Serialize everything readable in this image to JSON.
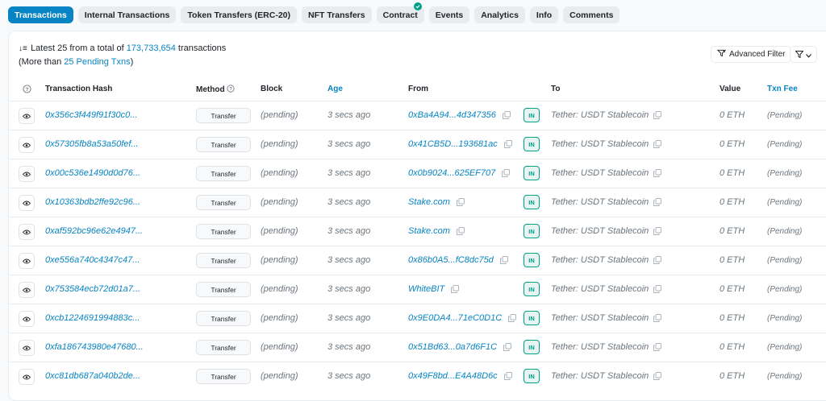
{
  "tabs": [
    {
      "label": "Transactions",
      "active": true
    },
    {
      "label": "Internal Transactions"
    },
    {
      "label": "Token Transfers (ERC-20)"
    },
    {
      "label": "NFT Transfers"
    },
    {
      "label": "Contract",
      "verified": true
    },
    {
      "label": "Events"
    },
    {
      "label": "Analytics"
    },
    {
      "label": "Info"
    },
    {
      "label": "Comments"
    }
  ],
  "summary": {
    "prefix": "Latest 25 from a total of ",
    "total": "173,733,654",
    "suffix": " transactions",
    "pending_prefix": "(More than ",
    "pending_link": "25 Pending Txns",
    "pending_suffix": ")"
  },
  "toolbar": {
    "advanced_filter": "Advanced Filter"
  },
  "columns": {
    "hash": "Transaction Hash",
    "method": "Method",
    "block": "Block",
    "age": "Age",
    "from": "From",
    "to": "To",
    "value": "Value",
    "fee": "Txn Fee"
  },
  "rows": [
    {
      "hash": "0x356c3f449f91f30c0...",
      "method": "Transfer",
      "block": "(pending)",
      "age": "3 secs ago",
      "from": "0xBa4A94...4d347356",
      "dir": "IN",
      "to": "Tether: USDT Stablecoin",
      "value": "0 ETH",
      "fee": "(Pending)"
    },
    {
      "hash": "0x57305fb8a53a50fef...",
      "method": "Transfer",
      "block": "(pending)",
      "age": "3 secs ago",
      "from": "0x41CB5D...193681ac",
      "dir": "IN",
      "to": "Tether: USDT Stablecoin",
      "value": "0 ETH",
      "fee": "(Pending)"
    },
    {
      "hash": "0x00c536e1490d0d76...",
      "method": "Transfer",
      "block": "(pending)",
      "age": "3 secs ago",
      "from": "0x0b9024...625EF707",
      "dir": "IN",
      "to": "Tether: USDT Stablecoin",
      "value": "0 ETH",
      "fee": "(Pending)"
    },
    {
      "hash": "0x10363bdb2ffe92c96...",
      "method": "Transfer",
      "block": "(pending)",
      "age": "3 secs ago",
      "from": "Stake.com",
      "dir": "IN",
      "to": "Tether: USDT Stablecoin",
      "value": "0 ETH",
      "fee": "(Pending)"
    },
    {
      "hash": "0xaf592bc96e62e4947...",
      "method": "Transfer",
      "block": "(pending)",
      "age": "3 secs ago",
      "from": "Stake.com",
      "dir": "IN",
      "to": "Tether: USDT Stablecoin",
      "value": "0 ETH",
      "fee": "(Pending)"
    },
    {
      "hash": "0xe556a740c4347c47...",
      "method": "Transfer",
      "block": "(pending)",
      "age": "3 secs ago",
      "from": "0x86b0A5...fC8dc75d",
      "dir": "IN",
      "to": "Tether: USDT Stablecoin",
      "value": "0 ETH",
      "fee": "(Pending)"
    },
    {
      "hash": "0x753584ecb72d01a7...",
      "method": "Transfer",
      "block": "(pending)",
      "age": "3 secs ago",
      "from": "WhiteBIT",
      "dir": "IN",
      "to": "Tether: USDT Stablecoin",
      "value": "0 ETH",
      "fee": "(Pending)"
    },
    {
      "hash": "0xcb1224691994883c...",
      "method": "Transfer",
      "block": "(pending)",
      "age": "3 secs ago",
      "from": "0x9E0DA4...71eC0D1C",
      "dir": "IN",
      "to": "Tether: USDT Stablecoin",
      "value": "0 ETH",
      "fee": "(Pending)"
    },
    {
      "hash": "0xfa186743980e47680...",
      "method": "Transfer",
      "block": "(pending)",
      "age": "3 secs ago",
      "from": "0x51Bd63...0a7d6F1C",
      "dir": "IN",
      "to": "Tether: USDT Stablecoin",
      "value": "0 ETH",
      "fee": "(Pending)"
    },
    {
      "hash": "0xc81db687a040b2de...",
      "method": "Transfer",
      "block": "(pending)",
      "age": "3 secs ago",
      "from": "0x49F8bd...E4A48D6c",
      "dir": "IN",
      "to": "Tether: USDT Stablecoin",
      "value": "0 ETH",
      "fee": "(Pending)"
    }
  ],
  "colors": {
    "accent": "#0784c3",
    "success": "#00a186"
  }
}
